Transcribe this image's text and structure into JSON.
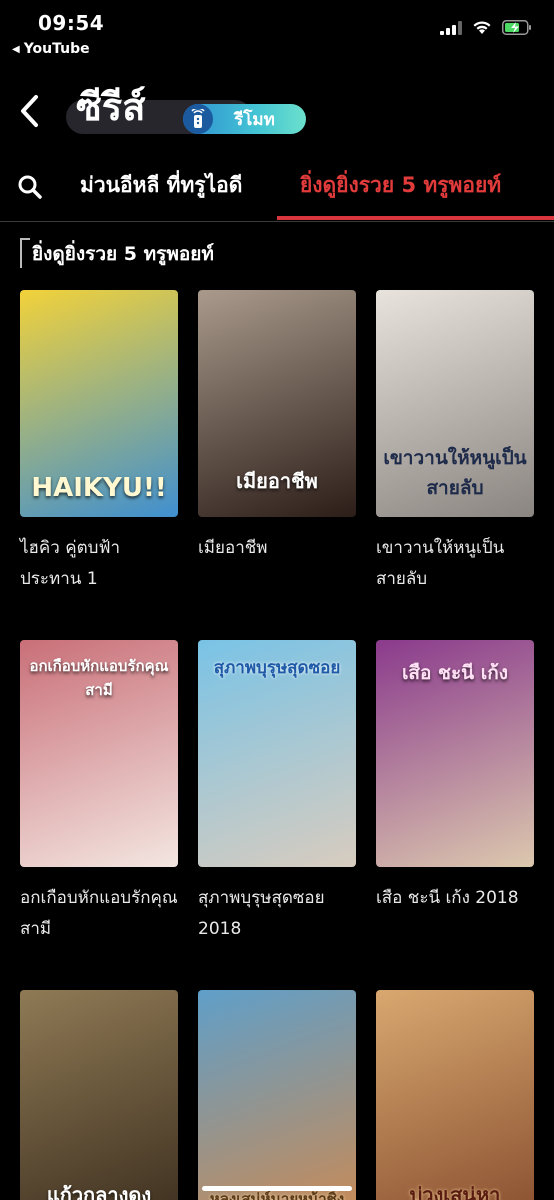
{
  "status_bar": {
    "time": "09:54",
    "back_app": "YouTube"
  },
  "header": {
    "title": "ซีรีส์",
    "remote_label": "รีโมท"
  },
  "tabs": [
    {
      "label": "ม่วนอีหลี ที่ทรูไอดี",
      "active": false
    },
    {
      "label": "ยิ่งดูยิ่งรวย 5 ทรูพอยท์",
      "active": true
    }
  ],
  "section": {
    "title": "ยิ่งดูยิ่งรวย 5 ทรูพอยท์"
  },
  "items": [
    {
      "title": "ไฮคิว คู่ตบฟ้าประทาน 1",
      "poster_text": "HAIKYU!!",
      "colors": [
        "#f2d23a",
        "#3f8fd0"
      ]
    },
    {
      "title": "เมียอาชีพ",
      "poster_text": "เมียอาชีพ",
      "colors": [
        "#a99a8c",
        "#2c1d18"
      ]
    },
    {
      "title": "เขาวานให้หนูเป็นสายลับ",
      "poster_text": "เขาวานให้หนูเป็นสายลับ",
      "colors": [
        "#e9e3dd",
        "#8a8580"
      ]
    },
    {
      "title": "อกเกือบหักแอบรักคุณสามี",
      "poster_text": "อกเกือบหักแอบรักคุณสามี",
      "colors": [
        "#c96f78",
        "#f3e6e1"
      ]
    },
    {
      "title": "สุภาพบุรุษสุดซอย 2018",
      "poster_text": "สุภาพบุรุษสุดซอย",
      "colors": [
        "#79c3e6",
        "#d8ccbf"
      ]
    },
    {
      "title": "เสือ ชะนี เก้ง 2018",
      "poster_text": "เสือ ชะนี เก้ง",
      "colors": [
        "#8a3a8c",
        "#dcc8ae"
      ]
    },
    {
      "title": "",
      "poster_text": "แก้วกลางดง",
      "colors": [
        "#8f7a55",
        "#3e3020"
      ]
    },
    {
      "title": "",
      "poster_text": "หลงเสน่ห์นายหน้าชิ้ง",
      "colors": [
        "#5f9fc9",
        "#c98a55"
      ]
    },
    {
      "title": "",
      "poster_text": "บ่วงเสน่หา",
      "colors": [
        "#d8a870",
        "#8a5030"
      ]
    }
  ]
}
